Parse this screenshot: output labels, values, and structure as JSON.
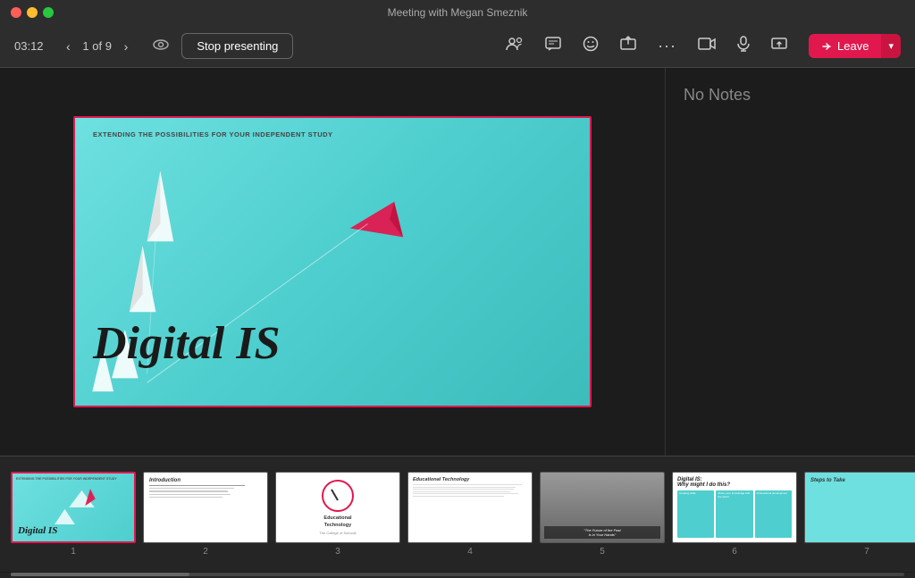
{
  "titleBar": {
    "title": "Meeting with Megan Smeznik"
  },
  "toolbar": {
    "timer": "03:12",
    "navPrev": "‹",
    "navNext": "›",
    "slideCount": "1 of 9",
    "eyeIcon": "👁",
    "stopPresenting": "Stop presenting",
    "icons": {
      "people": "⠿",
      "chat": "💬",
      "reactions": "😊",
      "share": "⬆",
      "more": "···",
      "video": "📷",
      "mic": "🎤",
      "shareScreen": "⬆"
    },
    "leaveBtn": "Leave"
  },
  "mainSlide": {
    "subtitle": "EXTENDING THE POSSIBILITIES FOR YOUR INDEPENDENT STUDY",
    "title": "Digital IS"
  },
  "notes": {
    "text": "No Notes"
  },
  "thumbnails": [
    {
      "num": "1",
      "active": true,
      "type": "digital-is"
    },
    {
      "num": "2",
      "active": false,
      "type": "introduction"
    },
    {
      "num": "3",
      "active": false,
      "type": "ed-tech-logo"
    },
    {
      "num": "4",
      "active": false,
      "type": "ed-tech-text"
    },
    {
      "num": "5",
      "active": false,
      "type": "photo"
    },
    {
      "num": "6",
      "active": false,
      "type": "digital-is-why"
    },
    {
      "num": "7",
      "active": false,
      "type": "steps"
    }
  ]
}
